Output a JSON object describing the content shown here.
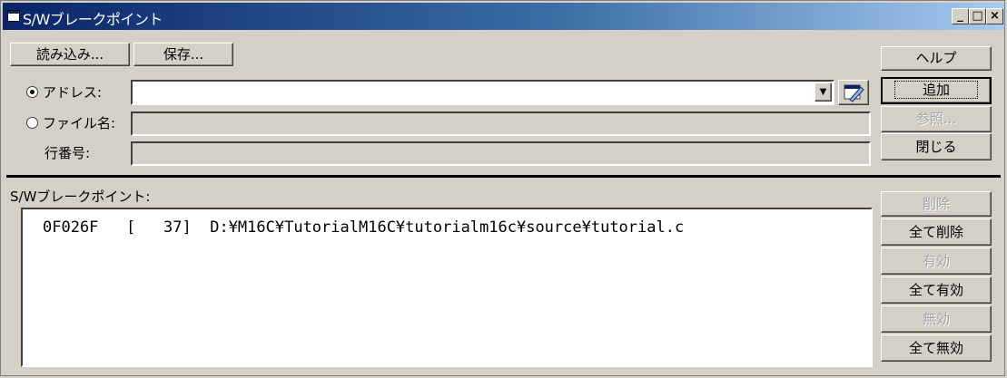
{
  "window": {
    "title": "S/Wブレークポイント",
    "minimize_icon": "minimize-icon",
    "maximize_icon": "maximize-icon",
    "close_icon": "close-icon"
  },
  "toolbar": {
    "load_label": "読み込み...",
    "save_label": "保存..."
  },
  "form": {
    "address_label": "アドレス:",
    "address_selected": true,
    "address_value": "",
    "filename_label": "ファイル名:",
    "filename_value": "",
    "line_label": "行番号:",
    "line_value": "",
    "browse_icon": "pencil-edit-icon"
  },
  "right_buttons": {
    "help": "ヘルプ",
    "add": "追加",
    "reference": "参照...",
    "close": "閉じる",
    "delete": "削除",
    "delete_all": "全て削除",
    "enable": "有効",
    "enable_all": "全て有効",
    "disable": "無効",
    "disable_all": "全て無効"
  },
  "list": {
    "header": "S/Wブレークポイント:",
    "rows": [
      {
        "text": "0F026F   [   37]  D:¥M16C¥TutorialM16C¥tutorialm16c¥source¥tutorial.c"
      }
    ]
  },
  "colors": {
    "face": "#d4d0c8",
    "title_start": "#0a246a",
    "title_end": "#a6caf0"
  }
}
